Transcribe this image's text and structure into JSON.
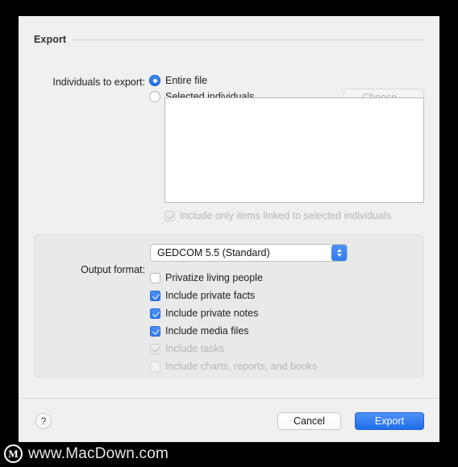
{
  "window": {
    "section_title": "Export"
  },
  "individuals": {
    "label": "Individuals to export:",
    "options": [
      {
        "label": "Entire file",
        "selected": true
      },
      {
        "label": "Selected individuals",
        "selected": false
      }
    ],
    "choose_button": "Choose...",
    "linked_checkbox": {
      "label": "Include only items linked to selected individuals",
      "checked": true,
      "enabled": false
    }
  },
  "output": {
    "label": "Output format:",
    "selected_value": "GEDCOM 5.5 (Standard)",
    "options": [
      {
        "label": "Privatize living people",
        "checked": false,
        "enabled": true
      },
      {
        "label": "Include private facts",
        "checked": true,
        "enabled": true
      },
      {
        "label": "Include private notes",
        "checked": true,
        "enabled": true
      },
      {
        "label": "Include media files",
        "checked": true,
        "enabled": true
      },
      {
        "label": "Include tasks",
        "checked": true,
        "enabled": false
      },
      {
        "label": "Include charts, reports, and books",
        "checked": false,
        "enabled": false
      }
    ]
  },
  "footer": {
    "help_label": "?",
    "cancel_label": "Cancel",
    "export_label": "Export"
  },
  "watermark": {
    "logo_letter": "M",
    "text": "www.MacDown.com"
  },
  "colors": {
    "accent_blue": "#2f7cf0",
    "window_bg": "#f0f0f0",
    "group_bg": "#e9e9e9"
  }
}
